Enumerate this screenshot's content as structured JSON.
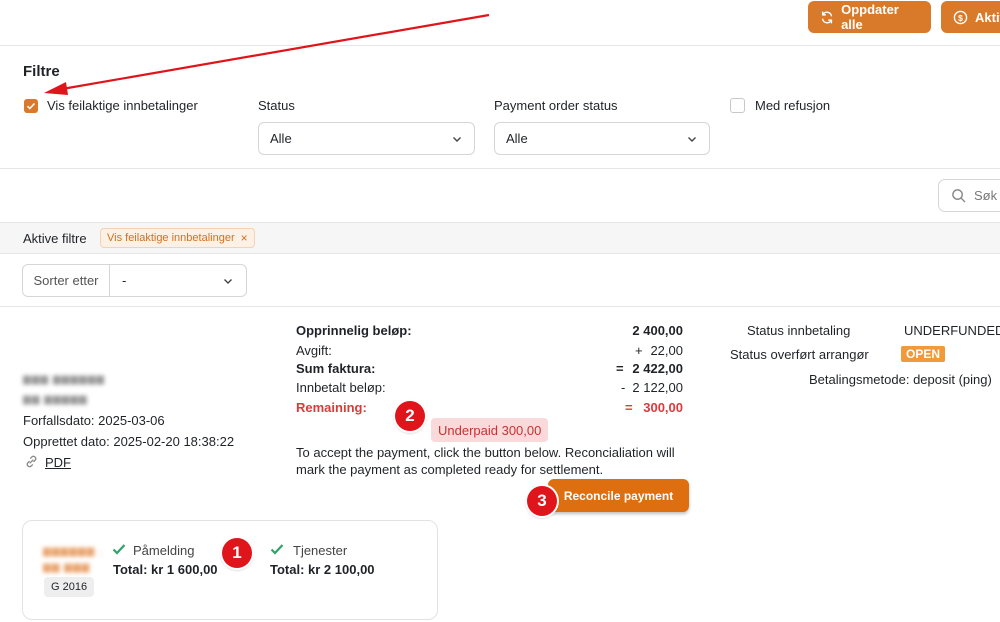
{
  "header": {
    "refresh_all_label": "Oppdater alle",
    "activate_label": "Aktiv"
  },
  "filters": {
    "title": "Filtre",
    "show_faulty_label": "Vis feilaktige innbetalinger",
    "status_label": "Status",
    "status_value": "Alle",
    "payment_order_status_label": "Payment order status",
    "payment_order_status_value": "Alle",
    "with_refund_label": "Med refusjon"
  },
  "search": {
    "placeholder": "Søk"
  },
  "active_filters": {
    "label": "Aktive filtre",
    "chip_label": "Vis feilaktige innbetalinger",
    "chip_remove": "×"
  },
  "sort": {
    "label": "Sorter etter",
    "value": "-"
  },
  "invoice": {
    "due_date": "Forfallsdato: 2025-03-06",
    "created_date": "Opprettet dato: 2025-02-20 18:38:22",
    "pdf_label": "PDF",
    "amounts": [
      {
        "label": "Opprinnelig beløp:",
        "sign": "",
        "value": "2 400,00",
        "style": "bold"
      },
      {
        "label": "Avgift:",
        "sign": "+",
        "value": "22,00",
        "style": "normal"
      },
      {
        "label": "Sum faktura:",
        "sign": "=",
        "value": "2 422,00",
        "style": "bold"
      },
      {
        "label": "Innbetalt beløp:",
        "sign": "-",
        "value": "2 122,00",
        "style": "normal"
      },
      {
        "label": "Remaining:",
        "sign": "=",
        "value": "300,00",
        "style": "red"
      }
    ],
    "underpaid_label": "Underpaid  300,00",
    "instruction_line1": "To accept the payment, click the button below. Reconcialiation will",
    "instruction_line2": "mark the payment as completed ready for settlement.",
    "reconcile_label": "Reconcile payment",
    "status_payment_label": "Status innbetaling",
    "status_payment_value": "UNDERFUNDED",
    "status_transfer_label": "Status overført arrangør",
    "status_transfer_value": "OPEN",
    "payment_method": "Betalingsmetode: deposit (ping)"
  },
  "card": {
    "grade": "G 2016",
    "items": [
      {
        "title": "Påmelding",
        "total": "Total: kr 1 600,00"
      },
      {
        "title": "Tjenester",
        "total": "Total: kr 2 100,00"
      }
    ]
  },
  "annotations": {
    "marker_1": "1",
    "marker_2": "2",
    "marker_3": "3"
  },
  "colors": {
    "accent_orange": "#d97a2b",
    "reconcile_orange": "#dd6f10",
    "remaining_red": "#d93b3b",
    "marker_red": "#e0141b",
    "check_green": "#2fa36b"
  }
}
